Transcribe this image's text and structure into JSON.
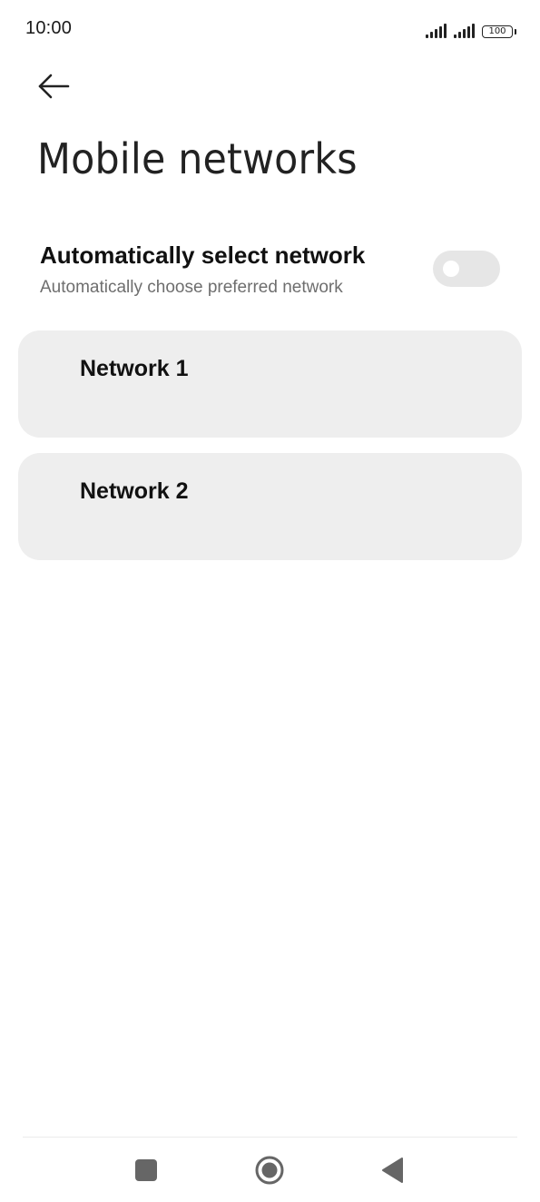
{
  "status_bar": {
    "time": "10:00",
    "battery": "100",
    "icons": [
      "signal-icon",
      "signal-icon",
      "battery-icon"
    ]
  },
  "header": {
    "back_icon": "arrow-left-icon",
    "title": "Mobile networks"
  },
  "auto_select": {
    "title": "Automatically select network",
    "subtitle": "Automatically choose preferred network",
    "enabled": false
  },
  "networks": [
    {
      "label": "Network 1"
    },
    {
      "label": "Network 2"
    }
  ],
  "nav_bar": {
    "icons": [
      "recents-square-icon",
      "home-circle-icon",
      "back-triangle-icon"
    ]
  },
  "colors": {
    "card_background": "#eeeeee",
    "toggle_off": "#e6e6e6",
    "subtitle_text": "#6e6e6e",
    "nav_icon": "#666666"
  }
}
